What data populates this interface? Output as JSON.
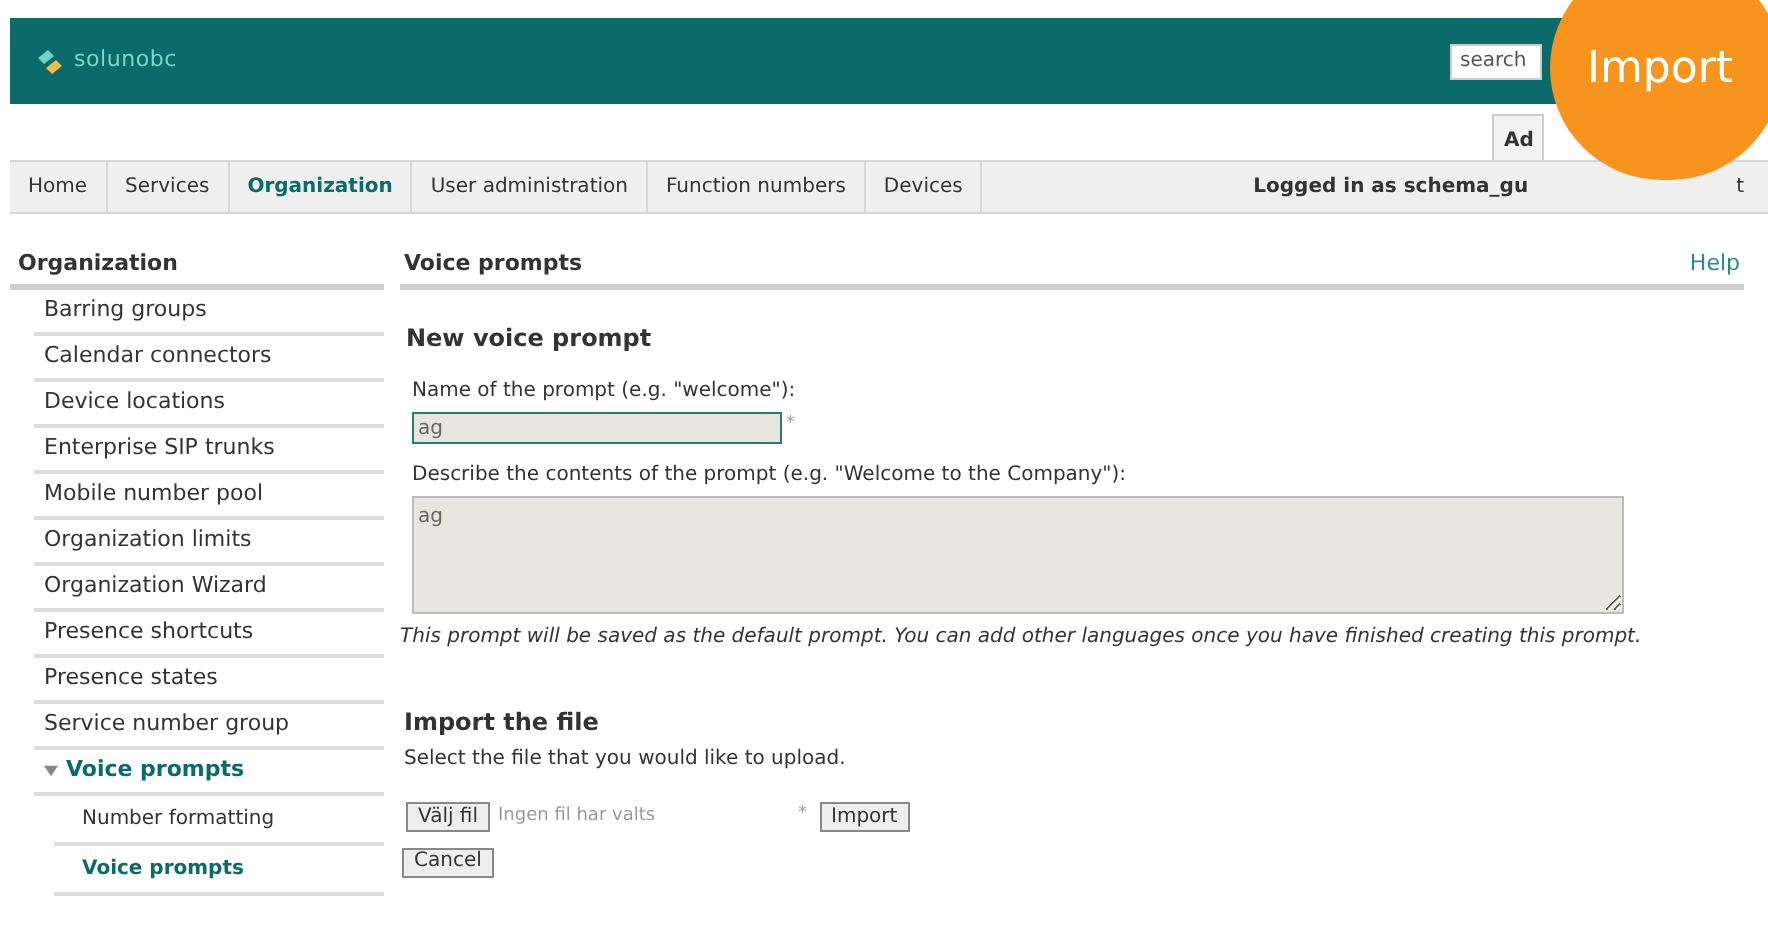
{
  "header": {
    "logo": "solunobc",
    "search": {
      "placeholder": "search"
    },
    "tab_fragment": "Ad"
  },
  "overlay_badge": "Import",
  "nav": {
    "items": [
      {
        "label": "Home",
        "selected": false
      },
      {
        "label": "Services",
        "selected": false
      },
      {
        "label": "Organization",
        "selected": true
      },
      {
        "label": "User administration",
        "selected": false
      },
      {
        "label": "Function numbers",
        "selected": false
      },
      {
        "label": "Devices",
        "selected": false
      }
    ],
    "login_text": "Logged in as schema_gu",
    "trailing_text": "t"
  },
  "sidebar": {
    "title": "Organization",
    "items": [
      {
        "label": "Barring groups",
        "selected": false
      },
      {
        "label": "Calendar connectors",
        "selected": false
      },
      {
        "label": "Device locations",
        "selected": false
      },
      {
        "label": "Enterprise SIP trunks",
        "selected": false
      },
      {
        "label": "Mobile number pool",
        "selected": false
      },
      {
        "label": "Organization limits",
        "selected": false
      },
      {
        "label": "Organization Wizard",
        "selected": false
      },
      {
        "label": "Presence shortcuts",
        "selected": false
      },
      {
        "label": "Presence states",
        "selected": false
      },
      {
        "label": "Service number group",
        "selected": false
      },
      {
        "label": "Voice prompts",
        "selected": true,
        "expanded": true,
        "children": [
          {
            "label": "Number formatting",
            "selected": false
          },
          {
            "label": "Voice prompts",
            "selected": true
          }
        ]
      }
    ]
  },
  "content": {
    "title": "Voice prompts",
    "help": "Help",
    "section_title": "New voice prompt",
    "name_label": "Name of the prompt (e.g. \"welcome\"):",
    "name_value": "ag",
    "required_mark": "*",
    "description_label": "Describe the contents of the prompt (e.g. \"Welcome to the Company\"):",
    "description_value": "ag",
    "note": "This prompt will be saved as the default prompt. You can add other languages once you have finished creating this prompt.",
    "import_title": "Import the file",
    "import_hint": "Select the file that you would like to upload.",
    "choose_button": "Välj fil",
    "no_file": "Ingen fil har valts",
    "import_required_mark": "*",
    "import_button": "Import",
    "cancel_button": "Cancel"
  }
}
